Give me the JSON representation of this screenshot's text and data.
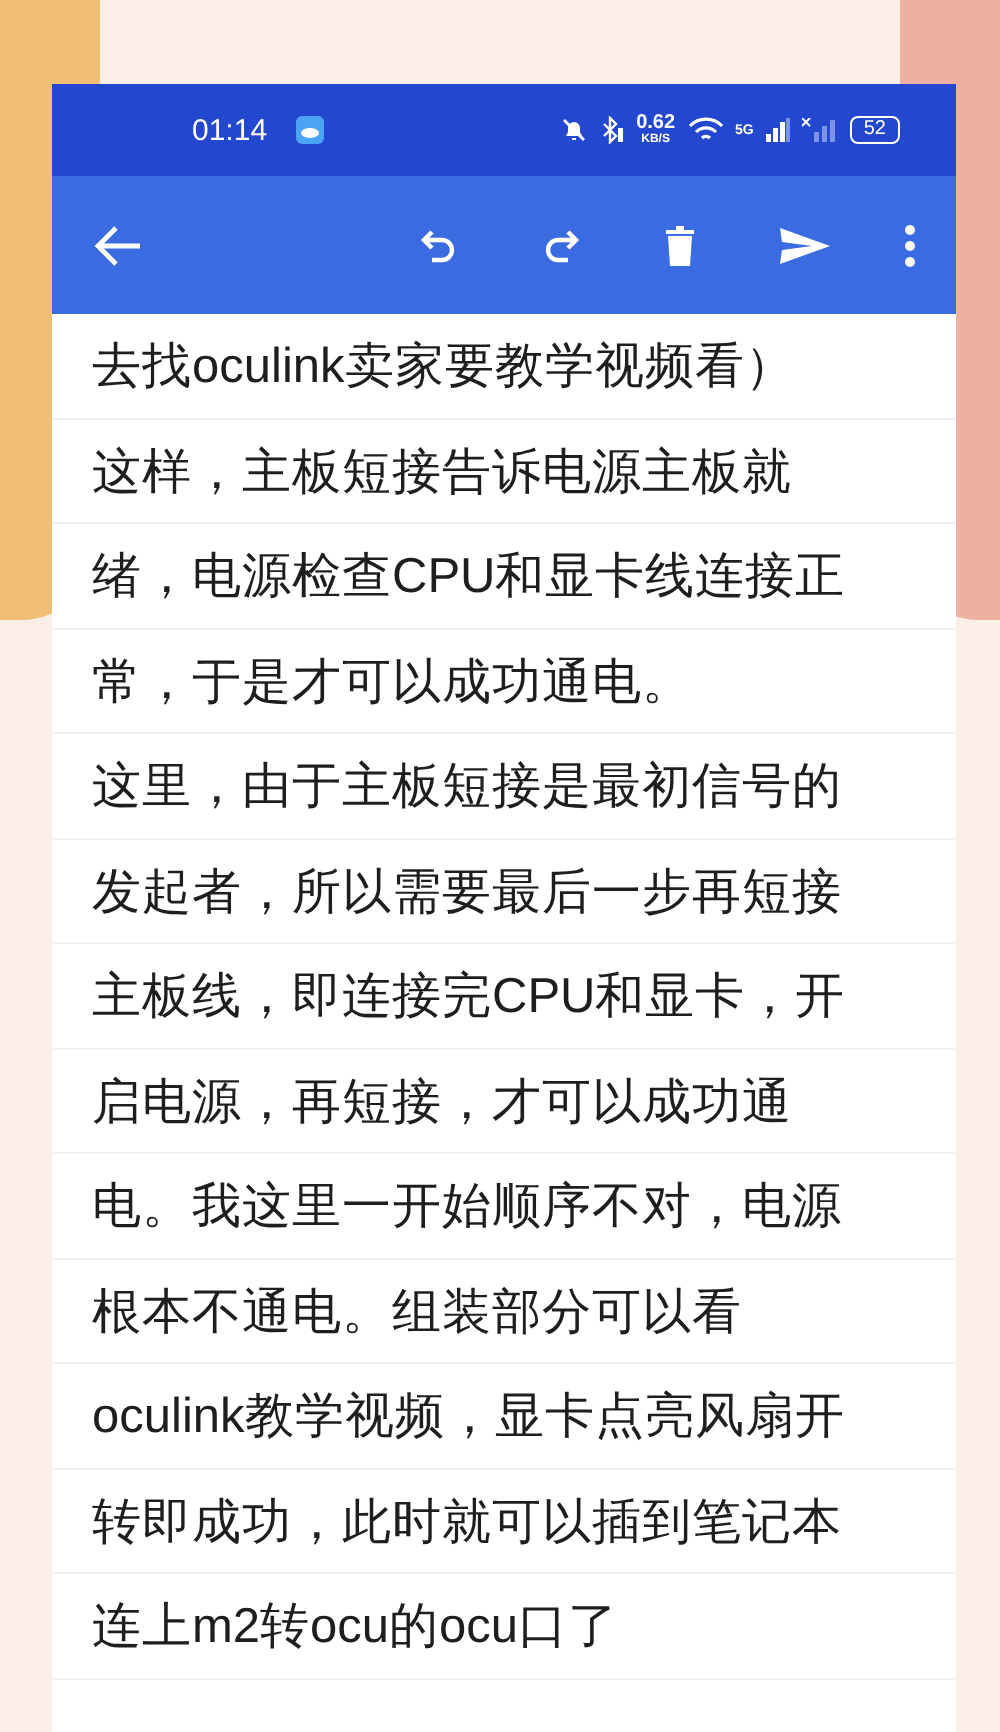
{
  "status_bar": {
    "time": "01:14",
    "speed": "0.62",
    "speed_unit": "KB/S",
    "network": "5G",
    "battery": "52"
  },
  "toolbar": {
    "actions": [
      {
        "kind": "undo"
      },
      {
        "kind": "redo"
      },
      {
        "kind": "delete"
      },
      {
        "kind": "send"
      },
      {
        "kind": "more"
      }
    ]
  },
  "note_lines": [
    "去找oculink卖家要教学视频看）",
    "这样，主板短接告诉电源主板就",
    "绪，电源检查CPU和显卡线连接正",
    "常，于是才可以成功通电。",
    "这里，由于主板短接是最初信号的",
    "发起者，所以需要最后一步再短接",
    "主板线，即连接完CPU和显卡，开",
    "启电源，再短接，才可以成功通",
    "电。我这里一开始顺序不对，电源",
    "根本不通电。组装部分可以看",
    "oculink教学视频，显卡点亮风扇开",
    "转即成功，此时就可以插到笔记本",
    "连上m2转ocu的ocu口了"
  ]
}
